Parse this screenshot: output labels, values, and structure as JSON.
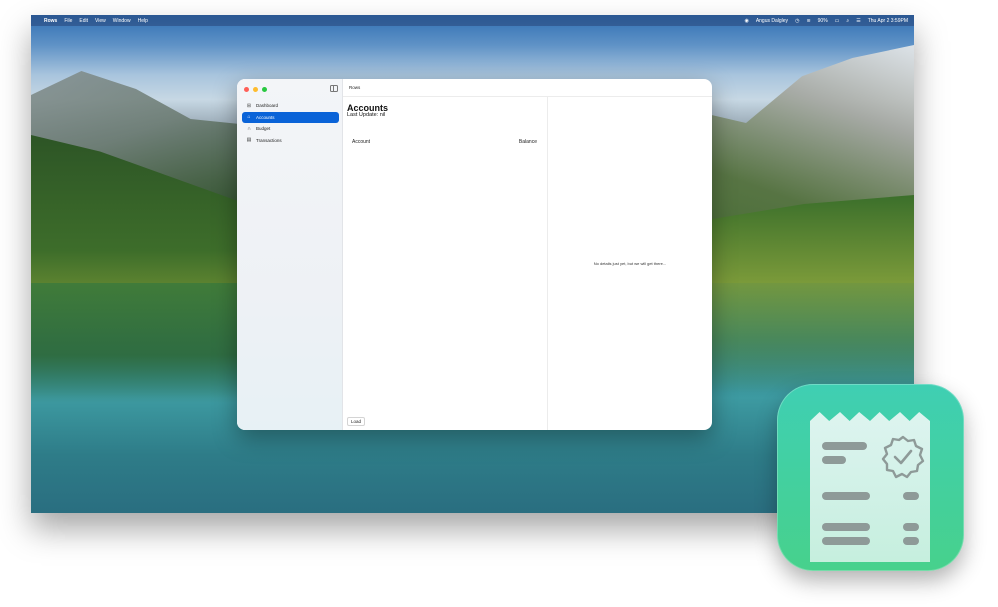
{
  "menubar": {
    "apple": "",
    "app_name": "Rows",
    "menus": [
      "File",
      "Edit",
      "View",
      "Window",
      "Help"
    ],
    "user": "Angus Dalgley",
    "battery": "90%",
    "datetime": "Thu Apr 2  3:59PM"
  },
  "window": {
    "title": "Rows",
    "sidebar": {
      "items": [
        {
          "label": "Dashboard",
          "icon": "dashboard-icon"
        },
        {
          "label": "Accounts",
          "icon": "bank-icon",
          "selected": true
        },
        {
          "label": "Budget",
          "icon": "budget-icon"
        },
        {
          "label": "Transactions",
          "icon": "transactions-icon"
        }
      ]
    },
    "content": {
      "heading": "Accounts",
      "subheading": "Last Update: nil",
      "columns": [
        "Account",
        "Balance"
      ],
      "load_button": "Load"
    },
    "detail": {
      "empty_message": "No details just yet, but we will get there..."
    }
  },
  "colors": {
    "accent": "#0a63d8",
    "app_icon": "#47d18c"
  }
}
